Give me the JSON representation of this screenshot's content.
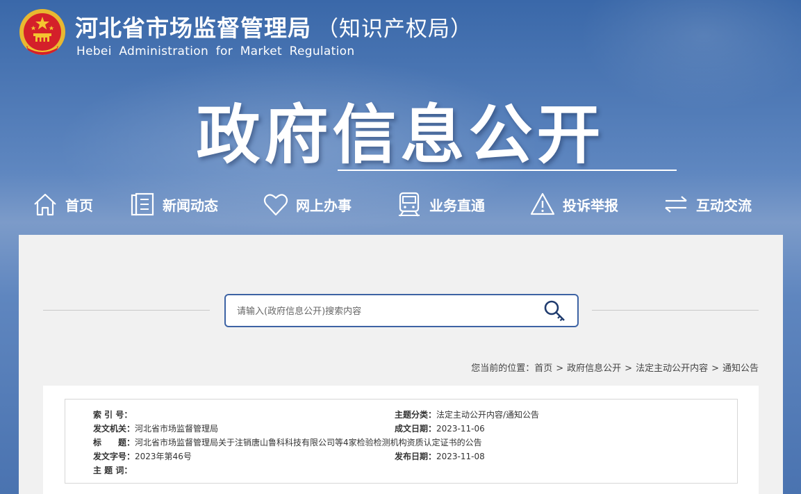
{
  "header": {
    "title": "河北省市场监督管理局",
    "title_sub": "（知识产权局）",
    "title_en": "Hebei Administration for Market Regulation",
    "banner_title": "政府信息公开"
  },
  "nav": {
    "items": [
      {
        "label": "首页",
        "icon": "home-icon"
      },
      {
        "label": "新闻动态",
        "icon": "document-icon"
      },
      {
        "label": "网上办事",
        "icon": "heart-icon"
      },
      {
        "label": "业务直通",
        "icon": "train-icon"
      },
      {
        "label": "投诉举报",
        "icon": "warning-icon"
      },
      {
        "label": "互动交流",
        "icon": "exchange-icon"
      }
    ]
  },
  "search": {
    "placeholder": "请输入(政府信息公开)搜索内容"
  },
  "breadcrumb": {
    "prefix": "您当前的位置：",
    "items": [
      "首页",
      "政府信息公开",
      "法定主动公开内容",
      "通知公告"
    ],
    "separator": ">"
  },
  "info": {
    "index_no": {
      "label": "索 引 号：",
      "value": ""
    },
    "category": {
      "label": "主题分类：",
      "value": "法定主动公开内容/通知公告"
    },
    "issuer": {
      "label": "发文机关：",
      "value": "河北省市场监督管理局"
    },
    "created_date": {
      "label": "成文日期：",
      "value": "2023-11-06"
    },
    "title": {
      "label": "标　　题：",
      "value": "河北省市场监督管理局关于注销唐山鲁科科技有限公司等4家检验检测机构资质认定证书的公告"
    },
    "doc_no": {
      "label": "发文字号：",
      "value": "2023年第46号"
    },
    "publish_date": {
      "label": "发布日期：",
      "value": "2023-11-08"
    },
    "keywords": {
      "label": "主 题 词：",
      "value": ""
    }
  },
  "colors": {
    "banner": "#3f6fae",
    "search_border": "#3d63a4",
    "panel": "#f1f1f1",
    "emblem_red": "#d4202a",
    "emblem_gold": "#f4c430"
  }
}
